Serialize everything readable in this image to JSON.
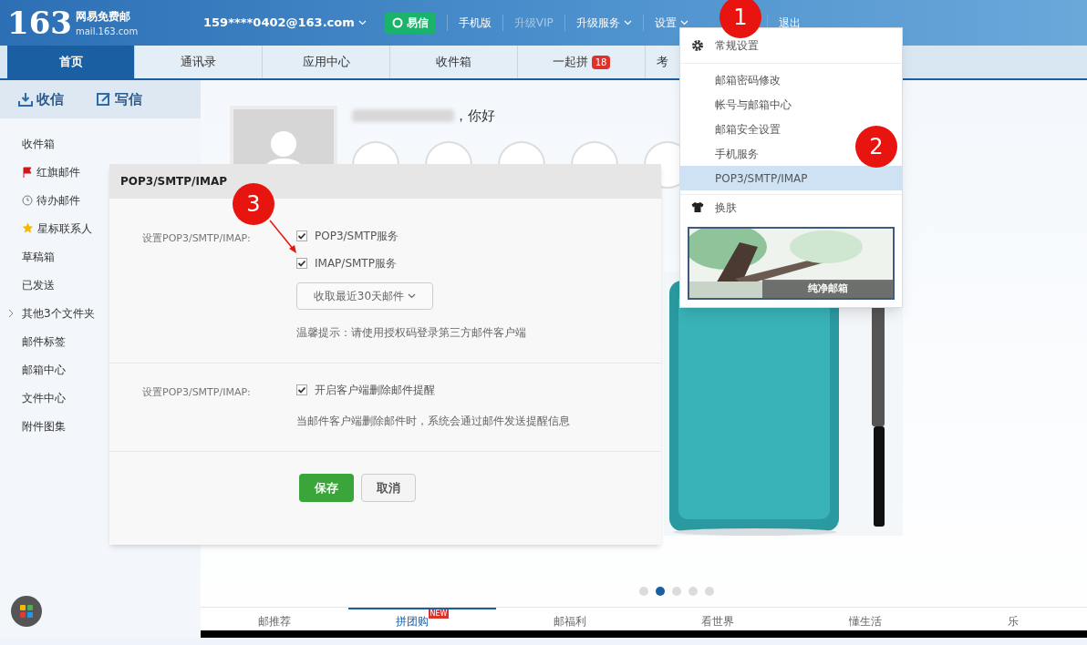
{
  "header": {
    "logo_number": "163",
    "logo_title": "网易免费邮",
    "logo_domain": "mail.163.com",
    "account": "159****0402@163.com",
    "links": [
      {
        "label": "易信",
        "kind": "badge"
      },
      {
        "label": "手机版",
        "kind": "link"
      },
      {
        "label": "升级VIP",
        "kind": "faded"
      },
      {
        "label": "升级服务",
        "kind": "dropdown"
      },
      {
        "label": "设置",
        "kind": "dropdown"
      },
      {
        "label": "退出",
        "kind": "link"
      }
    ]
  },
  "tabs": [
    {
      "label": "首页",
      "selected": true
    },
    {
      "label": "通讯录",
      "selected": false
    },
    {
      "label": "应用中心",
      "selected": false
    },
    {
      "label": "收件箱",
      "selected": false
    },
    {
      "label": "一起拼",
      "selected": false,
      "badge": "18"
    },
    {
      "label": "考",
      "selected": false
    }
  ],
  "sidebar": {
    "actions": [
      {
        "label": "收信",
        "kind": "receive"
      },
      {
        "label": "写信",
        "kind": "compose"
      }
    ],
    "folders": [
      {
        "label": "收件箱",
        "kind": "plain"
      },
      {
        "label": "红旗邮件",
        "kind": "flag"
      },
      {
        "label": "待办邮件",
        "kind": "clock"
      },
      {
        "label": "星标联系人",
        "kind": "star"
      },
      {
        "label": "草稿箱",
        "kind": "plain"
      },
      {
        "label": "已发送",
        "kind": "plain"
      },
      {
        "label": "其他3个文件夹",
        "kind": "expander"
      },
      {
        "label": "邮件标签",
        "kind": "plain"
      },
      {
        "label": "邮箱中心",
        "kind": "plain"
      },
      {
        "label": "文件中心",
        "kind": "plain"
      },
      {
        "label": "附件图集",
        "kind": "plain"
      }
    ]
  },
  "greeting": "，你好",
  "dialog": {
    "title": "POP3/SMTP/IMAP",
    "sections": [
      {
        "label": "设置POP3/SMTP/IMAP:",
        "options": [
          {
            "label": "POP3/SMTP服务",
            "checked": true
          },
          {
            "label": "IMAP/SMTP服务",
            "checked": true
          }
        ],
        "select": "收取最近30天邮件",
        "note": "温馨提示：请使用授权码登录第三方邮件客户端"
      },
      {
        "label": "设置POP3/SMTP/IMAP:",
        "options": [
          {
            "label": "开启客户端删除邮件提醒",
            "checked": true
          }
        ],
        "note": "当邮件客户端删除邮件时，系统会通过邮件发送提醒信息"
      }
    ],
    "buttons": [
      {
        "label": "保存",
        "kind": "primary"
      },
      {
        "label": "取消",
        "kind": "secondary"
      }
    ]
  },
  "settings_menu": {
    "items": [
      {
        "label": "常规设置",
        "kind": "gear",
        "selected": false
      },
      {
        "label": "邮箱密码修改",
        "kind": "sub",
        "selected": false
      },
      {
        "label": "帐号与邮箱中心",
        "kind": "sub",
        "selected": false
      },
      {
        "label": "邮箱安全设置",
        "kind": "sub",
        "selected": false
      },
      {
        "label": "手机服务",
        "kind": "sub",
        "selected": false
      },
      {
        "label": "POP3/SMTP/IMAP",
        "kind": "sub",
        "selected": true
      },
      {
        "label": "换肤",
        "kind": "shirt",
        "selected": false
      }
    ],
    "skin_caption": "纯净邮箱"
  },
  "carousel": {
    "dots": [
      {
        "selected": false
      },
      {
        "selected": true
      },
      {
        "selected": false
      },
      {
        "selected": false
      },
      {
        "selected": false
      }
    ]
  },
  "bottom_tabs": [
    {
      "label": "邮推荐",
      "selected": false
    },
    {
      "label": "拼团购",
      "selected": true,
      "badge": "NEW"
    },
    {
      "label": "邮福利",
      "selected": false
    },
    {
      "label": "看世界",
      "selected": false
    },
    {
      "label": "懂生活",
      "selected": false
    },
    {
      "label": "乐",
      "selected": false
    }
  ],
  "callouts": [
    "1",
    "2",
    "3"
  ]
}
